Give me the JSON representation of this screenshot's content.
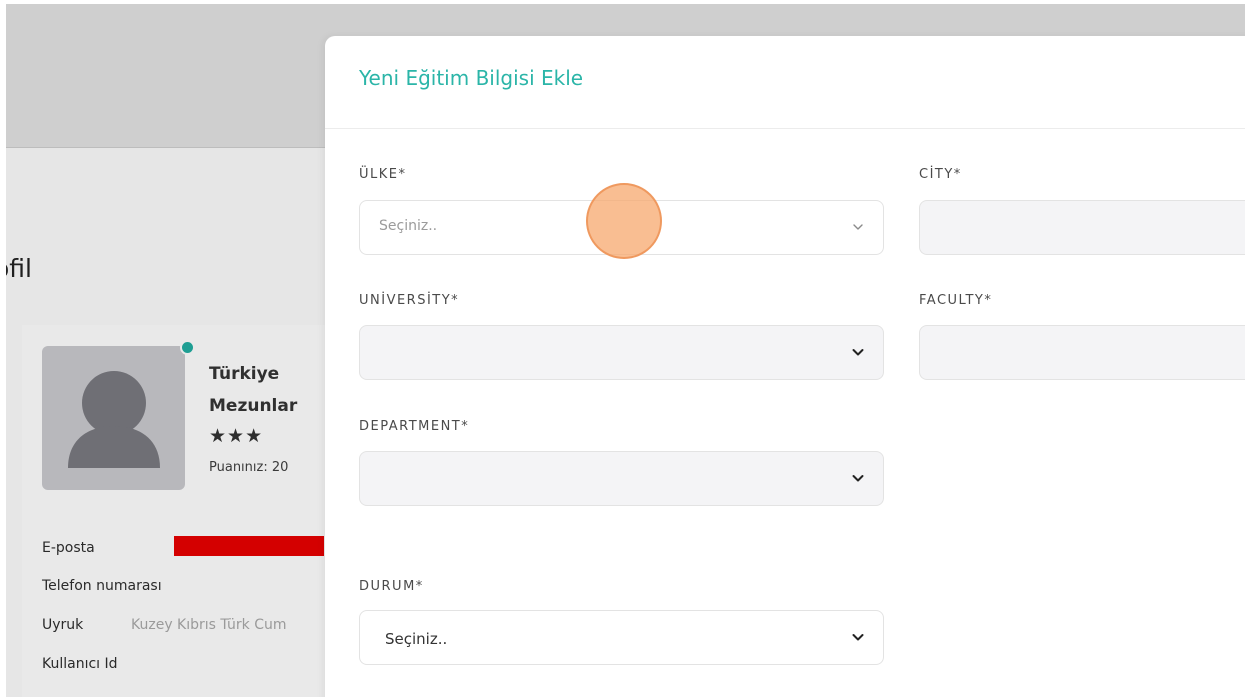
{
  "background": {
    "page_title": "ofil",
    "profile": {
      "name_line1": "Türkiye",
      "name_line2": "Mezunlar",
      "stars": "★★★",
      "score": "Puanınız: 20"
    },
    "info": {
      "email_label": "E-posta",
      "phone_label": "Telefon numarası",
      "nationality_label": "Uyruk",
      "nationality_value": "Kuzey Kıbrıs Türk Cum",
      "user_id_label": "Kullanıcı Id"
    }
  },
  "modal": {
    "title": "Yeni Eğitim Bilgisi Ekle",
    "fields": {
      "country": {
        "label": "ÜLKE*",
        "placeholder": "Seçiniz.."
      },
      "city": {
        "label": "CİTY*"
      },
      "university": {
        "label": "UNİVERSİTY*"
      },
      "faculty": {
        "label": "FACULTY*"
      },
      "department": {
        "label": "DEPARTMENT*"
      },
      "status": {
        "label": "DURUM*",
        "value": "Seçiniz.."
      }
    }
  },
  "colors": {
    "accent": "#2bb5a8",
    "online": "#1e9e93",
    "redaction": "#d40000",
    "click_indicator": "#f7a86e"
  }
}
